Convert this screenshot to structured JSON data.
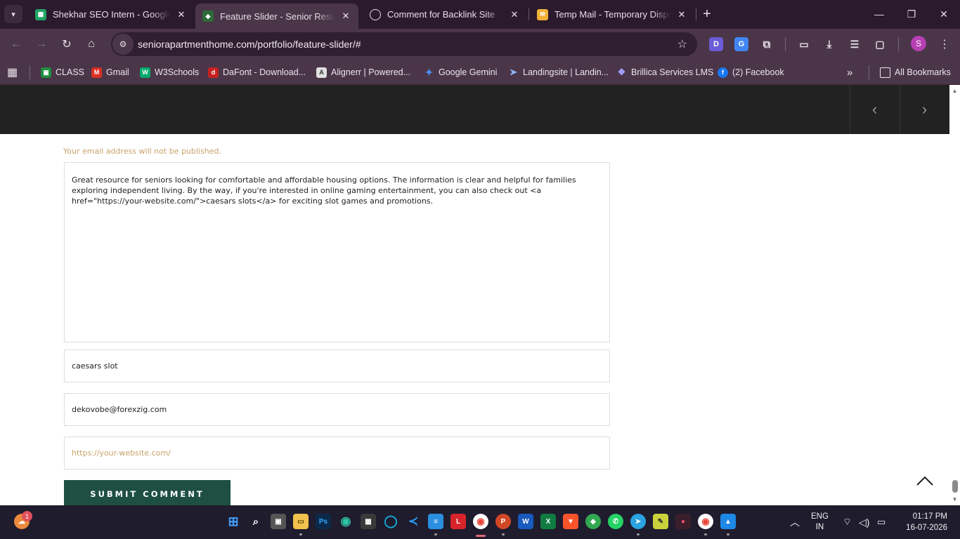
{
  "browser": {
    "tabs": [
      {
        "title": "Shekhar SEO Intern - Google Sheets",
        "favicon_color": "#1fa463",
        "active": false
      },
      {
        "title": "Feature Slider - Senior Residences",
        "favicon_color": "#2d6b3a",
        "active": true
      },
      {
        "title": "Comment for Backlink Site",
        "favicon_color": "#e0e0e0",
        "active": false
      },
      {
        "title": "Temp Mail - Temporary Disposable Email",
        "favicon_color": "#f2b134",
        "active": false
      }
    ],
    "new_tab_label": "+",
    "url": "seniorapartmenthome.com/portfolio/feature-slider/#",
    "profile_initial": "S",
    "bookmarks": [
      {
        "label": "CLASS",
        "icon": "google-classroom-icon",
        "color": "#1e8e3e"
      },
      {
        "label": "Gmail",
        "icon": "gmail-icon",
        "color": "#d93025"
      },
      {
        "label": "W3Schools",
        "icon": "w3schools-icon",
        "color": "#04aa6d"
      },
      {
        "label": "DaFont - Download...",
        "icon": "dafont-icon",
        "color": "#c5221f"
      },
      {
        "label": "Alignerr | Powered...",
        "icon": "alignerr-icon",
        "color": "#e0e0e0"
      },
      {
        "label": "Google Gemini",
        "icon": "gemini-icon",
        "color": "#4f8df5"
      },
      {
        "label": "Landingsite | Landin...",
        "icon": "landingsite-icon",
        "color": "#8ab4f8"
      },
      {
        "label": "Brillica Services LMS",
        "icon": "brillica-icon",
        "color": "#a3a3ff"
      },
      {
        "label": "(2) Facebook",
        "icon": "facebook-icon",
        "color": "#1877f2"
      }
    ],
    "all_bookmarks_label": "All Bookmarks"
  },
  "page": {
    "email_note": "Your email address will not be published.",
    "comment_text": "Great resource for seniors looking for comfortable and affordable housing options. The information is clear and helpful for families exploring independent living. By the way, if you're interested in online gaming entertainment, you can also check out <a href=\"https://your-website.com/\">caesars slots</a> for exciting slot games and promotions.",
    "name_value": "caesars slot",
    "email_value": "dekovobe@forexzig.com",
    "website_placeholder": "https://your-website.com/",
    "submit_label": "SUBMIT COMMENT"
  },
  "taskbar": {
    "notification_count": "1",
    "lang_line1": "ENG",
    "lang_line2": "IN",
    "time": "01:17 PM",
    "date": "16-07-2026"
  }
}
